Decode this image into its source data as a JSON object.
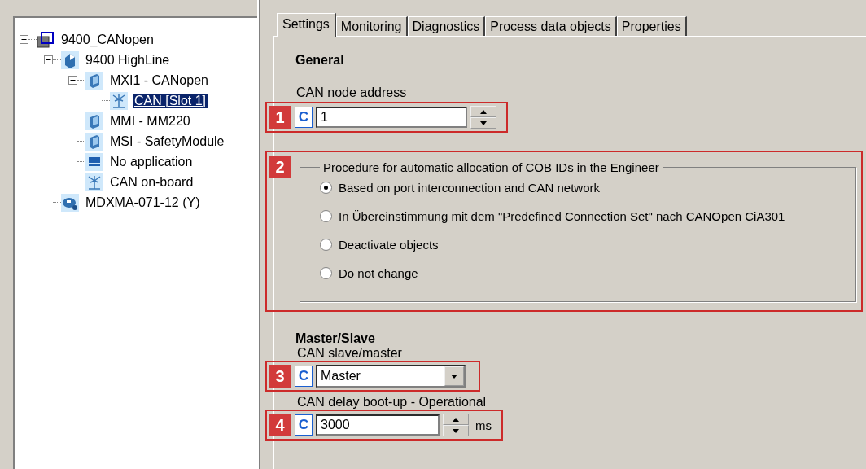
{
  "tree": [
    {
      "label": "9400_CANopen",
      "kind": "project",
      "expanded": true,
      "selected": false,
      "children": [
        {
          "label": "9400 HighLine",
          "kind": "device",
          "expanded": true,
          "selected": false,
          "children": [
            {
              "label": "MXI1 - CANopen",
              "kind": "module",
              "expanded": true,
              "selected": false,
              "children": [
                {
                  "label": "CAN [Slot 1]",
                  "kind": "bus",
                  "selected": true
                }
              ]
            },
            {
              "label": "MMI - MM220",
              "kind": "module",
              "selected": false
            },
            {
              "label": "MSI - SafetyModule",
              "kind": "module",
              "selected": false
            },
            {
              "label": "No application",
              "kind": "application",
              "selected": false
            },
            {
              "label": "CAN on-board",
              "kind": "bus",
              "selected": false
            }
          ]
        },
        {
          "label": "MDXMA-071-12 (Y)",
          "kind": "motor",
          "selected": false
        }
      ]
    }
  ],
  "tabs": [
    {
      "label": "Settings",
      "selected": true
    },
    {
      "label": "Monitoring",
      "selected": false
    },
    {
      "label": "Diagnostics",
      "selected": false
    },
    {
      "label": "Process data objects",
      "selected": false
    },
    {
      "label": "Properties",
      "selected": false
    }
  ],
  "general": {
    "heading": "General",
    "node_address": {
      "label": "CAN node address",
      "marker": "1",
      "badge": "C",
      "value": "1"
    }
  },
  "cob_group": {
    "marker": "2",
    "legend": "Procedure for automatic allocation of COB IDs in the Engineer",
    "options": [
      {
        "label": "Based on port interconnection and CAN network",
        "selected": true
      },
      {
        "label": "In Übereinstimmung mit dem \"Predefined Connection Set\" nach CANOpen CiA301",
        "selected": false
      },
      {
        "label": "Deactivate objects",
        "selected": false
      },
      {
        "label": "Do not change",
        "selected": false
      }
    ]
  },
  "master_slave": {
    "heading": "Master/Slave",
    "mode": {
      "label": "CAN slave/master",
      "marker": "3",
      "badge": "C",
      "value": "Master"
    },
    "delay": {
      "label": "CAN delay boot-up - Operational",
      "marker": "4",
      "badge": "C",
      "value": "3000",
      "unit": "ms"
    }
  }
}
